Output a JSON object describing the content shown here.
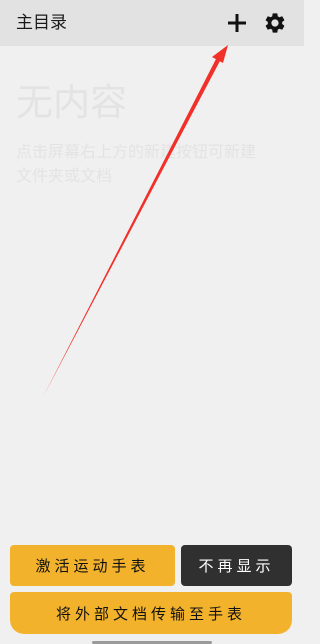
{
  "header": {
    "title": "主目录",
    "add_icon": "plus-icon",
    "settings_icon": "gear-icon"
  },
  "empty_state": {
    "title": "无内容",
    "hint": "点击屏幕右上方的新建按钮可新建文件夹或文档"
  },
  "actions": {
    "activate_label": "激活运动手表",
    "dismiss_label": "不再显示",
    "transfer_label": "将外部文档传输至手表"
  },
  "colors": {
    "header_bg": "#e2e2e2",
    "page_bg": "#f0f0f0",
    "accent": "#f2b22b",
    "dark_button": "#303030",
    "annotation_arrow": "#f2302a"
  }
}
